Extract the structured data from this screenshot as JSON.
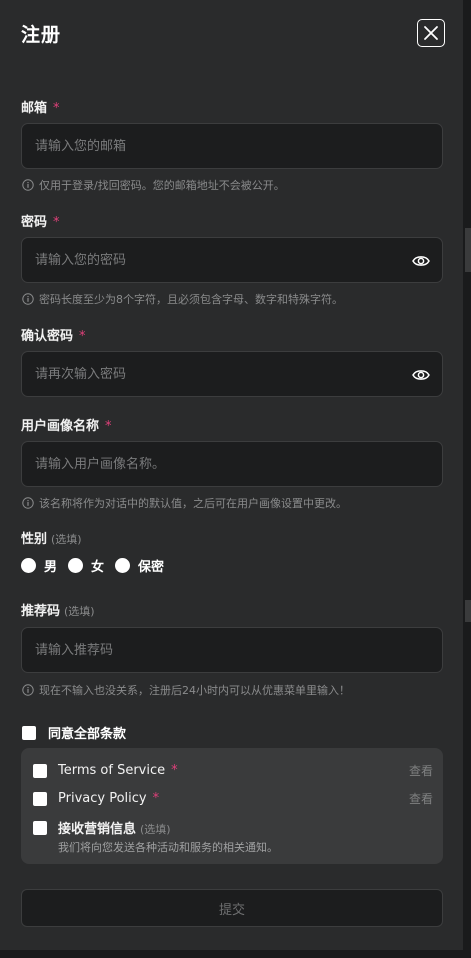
{
  "form": {
    "title": "注册",
    "required_mark": "*",
    "email": {
      "label": "邮箱",
      "placeholder": "请输入您的邮箱",
      "value": "",
      "hint": "仅用于登录/找回密码。您的邮箱地址不会被公开。"
    },
    "password": {
      "label": "密码",
      "placeholder": "请输入您的密码",
      "value": "",
      "hint": "密码长度至少为8个字符，且必须包含字母、数字和特殊字符。"
    },
    "confirm_password": {
      "label": "确认密码",
      "placeholder": "请再次输入密码",
      "value": ""
    },
    "display_name": {
      "label": "用户画像名称",
      "placeholder": "请输入用户画像名称。",
      "value": "",
      "hint": "该名称将作为对话中的默认值，之后可在用户画像设置中更改。"
    },
    "gender": {
      "label": "性别",
      "optional": "(选填)",
      "options": [
        "男",
        "女",
        "保密"
      ]
    },
    "referral": {
      "label": "推荐码",
      "optional": "(选填)",
      "placeholder": "请输入推荐码",
      "value": "",
      "hint": "现在不输入也没关系，注册后24小时内可以从优惠菜单里输入！"
    },
    "agree_all": "同意全部条款",
    "terms": [
      {
        "label": "Terms of Service",
        "view": "查看"
      },
      {
        "label": "Privacy Policy",
        "view": "查看"
      }
    ],
    "marketing": {
      "label": "接收营销信息",
      "optional": "(选填)",
      "sub": "我们将向您发送各种活动和服务的相关通知。"
    },
    "submit": "提交"
  },
  "icons": {
    "close": "close-icon",
    "eye": "eye-icon",
    "info": "info-icon"
  },
  "colors": {
    "panel": "#2a2b2c",
    "input_bg": "#1c1d1e",
    "required": "#e0407a",
    "muted": "#8a8b8c"
  }
}
